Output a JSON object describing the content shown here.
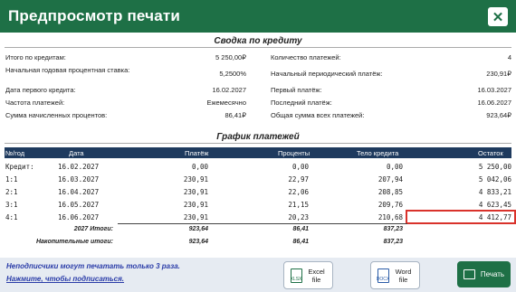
{
  "window": {
    "title": "Предпросмотр печати",
    "close_icon": "close-icon"
  },
  "summary": {
    "title": "Сводка по кредиту",
    "left": [
      {
        "label": "Итого по кредитам:",
        "value": "5 250,00₽"
      },
      {
        "label": "Начальная годовая процентная ставка:",
        "value": "5,2500%"
      },
      {
        "label": "Дата первого кредита:",
        "value": "16.02.2027"
      },
      {
        "label": "Частота платежей:",
        "value": "Ежемесячно"
      },
      {
        "label": "Сумма начисленных процентов:",
        "value": "86,41₽"
      }
    ],
    "right": [
      {
        "label": "Количество платежей:",
        "value": "4"
      },
      {
        "label": "Начальный периодический платёж:",
        "value": "230,91₽"
      },
      {
        "label": "Первый платёж:",
        "value": "16.03.2027"
      },
      {
        "label": "Последний платёж:",
        "value": "16.06.2027"
      },
      {
        "label": "Общая сумма всех платежей:",
        "value": "923,64₽"
      }
    ]
  },
  "schedule": {
    "title": "График платежей",
    "headers": {
      "num": "№/год",
      "date": "Дата",
      "payment": "Платёж",
      "interest": "Проценты",
      "principal": "Тело кредита",
      "balance": "Остаток"
    },
    "rows": [
      {
        "num": "Кредит:",
        "date": "16.02.2027",
        "payment": "0,00",
        "interest": "0,00",
        "principal": "0,00",
        "balance": "5 250,00"
      },
      {
        "num": "1:1",
        "date": "16.03.2027",
        "payment": "230,91",
        "interest": "22,97",
        "principal": "207,94",
        "balance": "5 042,06"
      },
      {
        "num": "2:1",
        "date": "16.04.2027",
        "payment": "230,91",
        "interest": "22,06",
        "principal": "208,85",
        "balance": "4 833,21"
      },
      {
        "num": "3:1",
        "date": "16.05.2027",
        "payment": "230,91",
        "interest": "21,15",
        "principal": "209,76",
        "balance": "4 623,45"
      },
      {
        "num": "4:1",
        "date": "16.06.2027",
        "payment": "230,91",
        "interest": "20,23",
        "principal": "210,68",
        "balance": "4 412,77"
      }
    ],
    "totals": [
      {
        "label": "2027 Итоги:",
        "payment": "923,64",
        "interest": "86,41",
        "principal": "837,23"
      },
      {
        "label": "Накопительные итоги:",
        "payment": "923,64",
        "interest": "86,41",
        "principal": "837,23"
      }
    ],
    "highlight_color": "#d9322b"
  },
  "footer": {
    "promo_line1": "Неподписчики могут печатать только 3 раза.",
    "promo_line2": "Нажмите, чтобы подписаться.",
    "excel_label": "Excel file",
    "word_label": "Word file",
    "print_label": "Печать",
    "excel_icon_text": "XLSX",
    "word_icon_text": "DOCX"
  },
  "colors": {
    "title_bar": "#1e7046",
    "table_header": "#1e3a5e",
    "footer_bg": "#e6ebf2",
    "promo_text": "#2a3ca8"
  }
}
